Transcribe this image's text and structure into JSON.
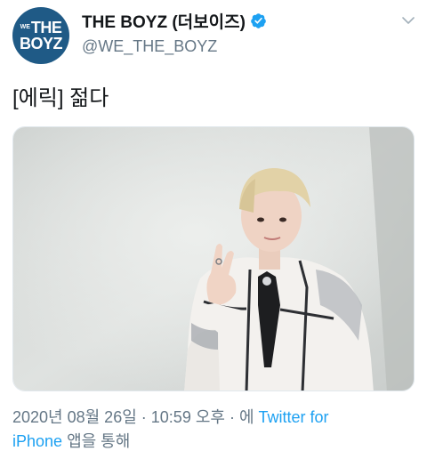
{
  "account": {
    "avatar_text_small": "WE",
    "avatar_text_top": "THE",
    "avatar_text_bottom": "BOYZ",
    "display_name": "THE BOYZ (더보이즈)",
    "handle": "@WE_THE_BOYZ",
    "verified": true
  },
  "icons": {
    "verified": "verified-badge-icon",
    "menu": "chevron-down-icon"
  },
  "tweet": {
    "text": "[에릭] 젊다",
    "media_description_color_bg": "#d9dcda",
    "date": "2020년 08월 26일",
    "sep1": " · ",
    "time": "10:59 오후",
    "sep2": " · 에 ",
    "source_part1": "Twitter for",
    "source_part2": "iPhone",
    "suffix": " 앱을 통해"
  },
  "colors": {
    "accent": "#1da1f2",
    "secondary_text": "#657786",
    "avatar_bg": "#1f5a86"
  }
}
